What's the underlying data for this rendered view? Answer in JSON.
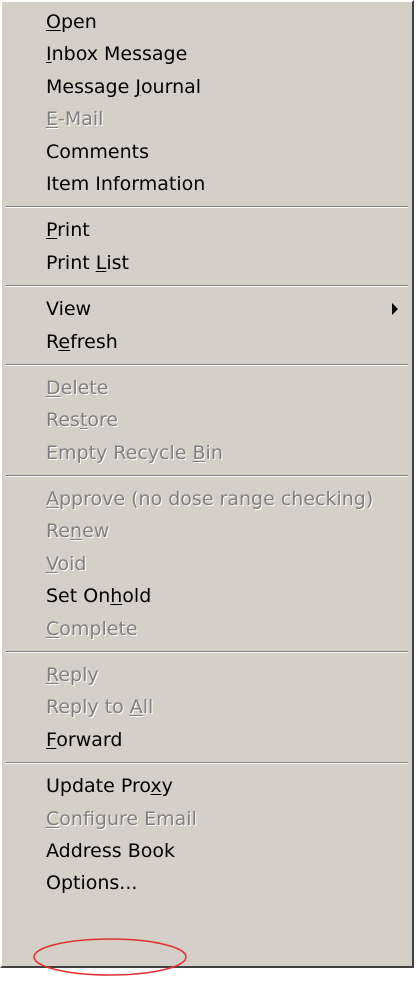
{
  "menu": {
    "groups": [
      [
        {
          "name": "menu-item-open",
          "label": "Open",
          "mnemonic": 0,
          "enabled": true
        },
        {
          "name": "menu-item-inbox-message",
          "label": "Inbox Message",
          "mnemonic": 0,
          "enabled": true
        },
        {
          "name": "menu-item-message-journal",
          "label": "Message Journal",
          "mnemonic": 8,
          "enabled": true
        },
        {
          "name": "menu-item-e-mail",
          "label": "E-Mail",
          "mnemonic": 0,
          "enabled": false
        },
        {
          "name": "menu-item-comments",
          "label": "Comments",
          "mnemonic": -1,
          "enabled": true
        },
        {
          "name": "menu-item-item-information",
          "label": "Item Information",
          "mnemonic": -1,
          "enabled": true
        }
      ],
      [
        {
          "name": "menu-item-print",
          "label": "Print",
          "mnemonic": 0,
          "enabled": true
        },
        {
          "name": "menu-item-print-list",
          "label": "Print List",
          "mnemonic": 6,
          "enabled": true
        }
      ],
      [
        {
          "name": "menu-item-view",
          "label": "View",
          "mnemonic": -1,
          "enabled": true,
          "submenu": true
        },
        {
          "name": "menu-item-refresh",
          "label": "Refresh",
          "mnemonic": 1,
          "enabled": true
        }
      ],
      [
        {
          "name": "menu-item-delete",
          "label": "Delete",
          "mnemonic": 0,
          "enabled": false
        },
        {
          "name": "menu-item-restore",
          "label": "Restore",
          "mnemonic": 3,
          "enabled": false
        },
        {
          "name": "menu-item-empty-recycle-bin",
          "label": "Empty Recycle Bin",
          "mnemonic": 14,
          "enabled": false
        }
      ],
      [
        {
          "name": "menu-item-approve",
          "label": "Approve (no dose range checking)",
          "mnemonic": 0,
          "enabled": false
        },
        {
          "name": "menu-item-renew",
          "label": "Renew",
          "mnemonic": 2,
          "enabled": false
        },
        {
          "name": "menu-item-void",
          "label": "Void",
          "mnemonic": 0,
          "enabled": false
        },
        {
          "name": "menu-item-set-onhold",
          "label": "Set Onhold",
          "mnemonic": 6,
          "enabled": true
        },
        {
          "name": "menu-item-complete",
          "label": "Complete",
          "mnemonic": 0,
          "enabled": false
        }
      ],
      [
        {
          "name": "menu-item-reply",
          "label": "Reply",
          "mnemonic": 0,
          "enabled": false
        },
        {
          "name": "menu-item-reply-to-all",
          "label": "Reply to All",
          "mnemonic": 9,
          "enabled": false
        },
        {
          "name": "menu-item-forward",
          "label": "Forward",
          "mnemonic": 0,
          "enabled": true
        }
      ],
      [
        {
          "name": "menu-item-update-proxy",
          "label": "Update Proxy",
          "mnemonic": 10,
          "enabled": true
        },
        {
          "name": "menu-item-configure-email",
          "label": "Configure Email",
          "mnemonic": 0,
          "enabled": false
        },
        {
          "name": "menu-item-address-book",
          "label": "Address Book",
          "mnemonic": -1,
          "enabled": true
        },
        {
          "name": "menu-item-options",
          "label": "Options...",
          "mnemonic": -1,
          "enabled": true,
          "circled": true
        }
      ]
    ],
    "colors": {
      "face": "#d4d0c8",
      "text": "#000000",
      "disabled_text": "#808080",
      "annotation": "#e03030"
    },
    "submenu_icon": "triangle-right-icon",
    "annotation_shape": "red-ellipse"
  }
}
